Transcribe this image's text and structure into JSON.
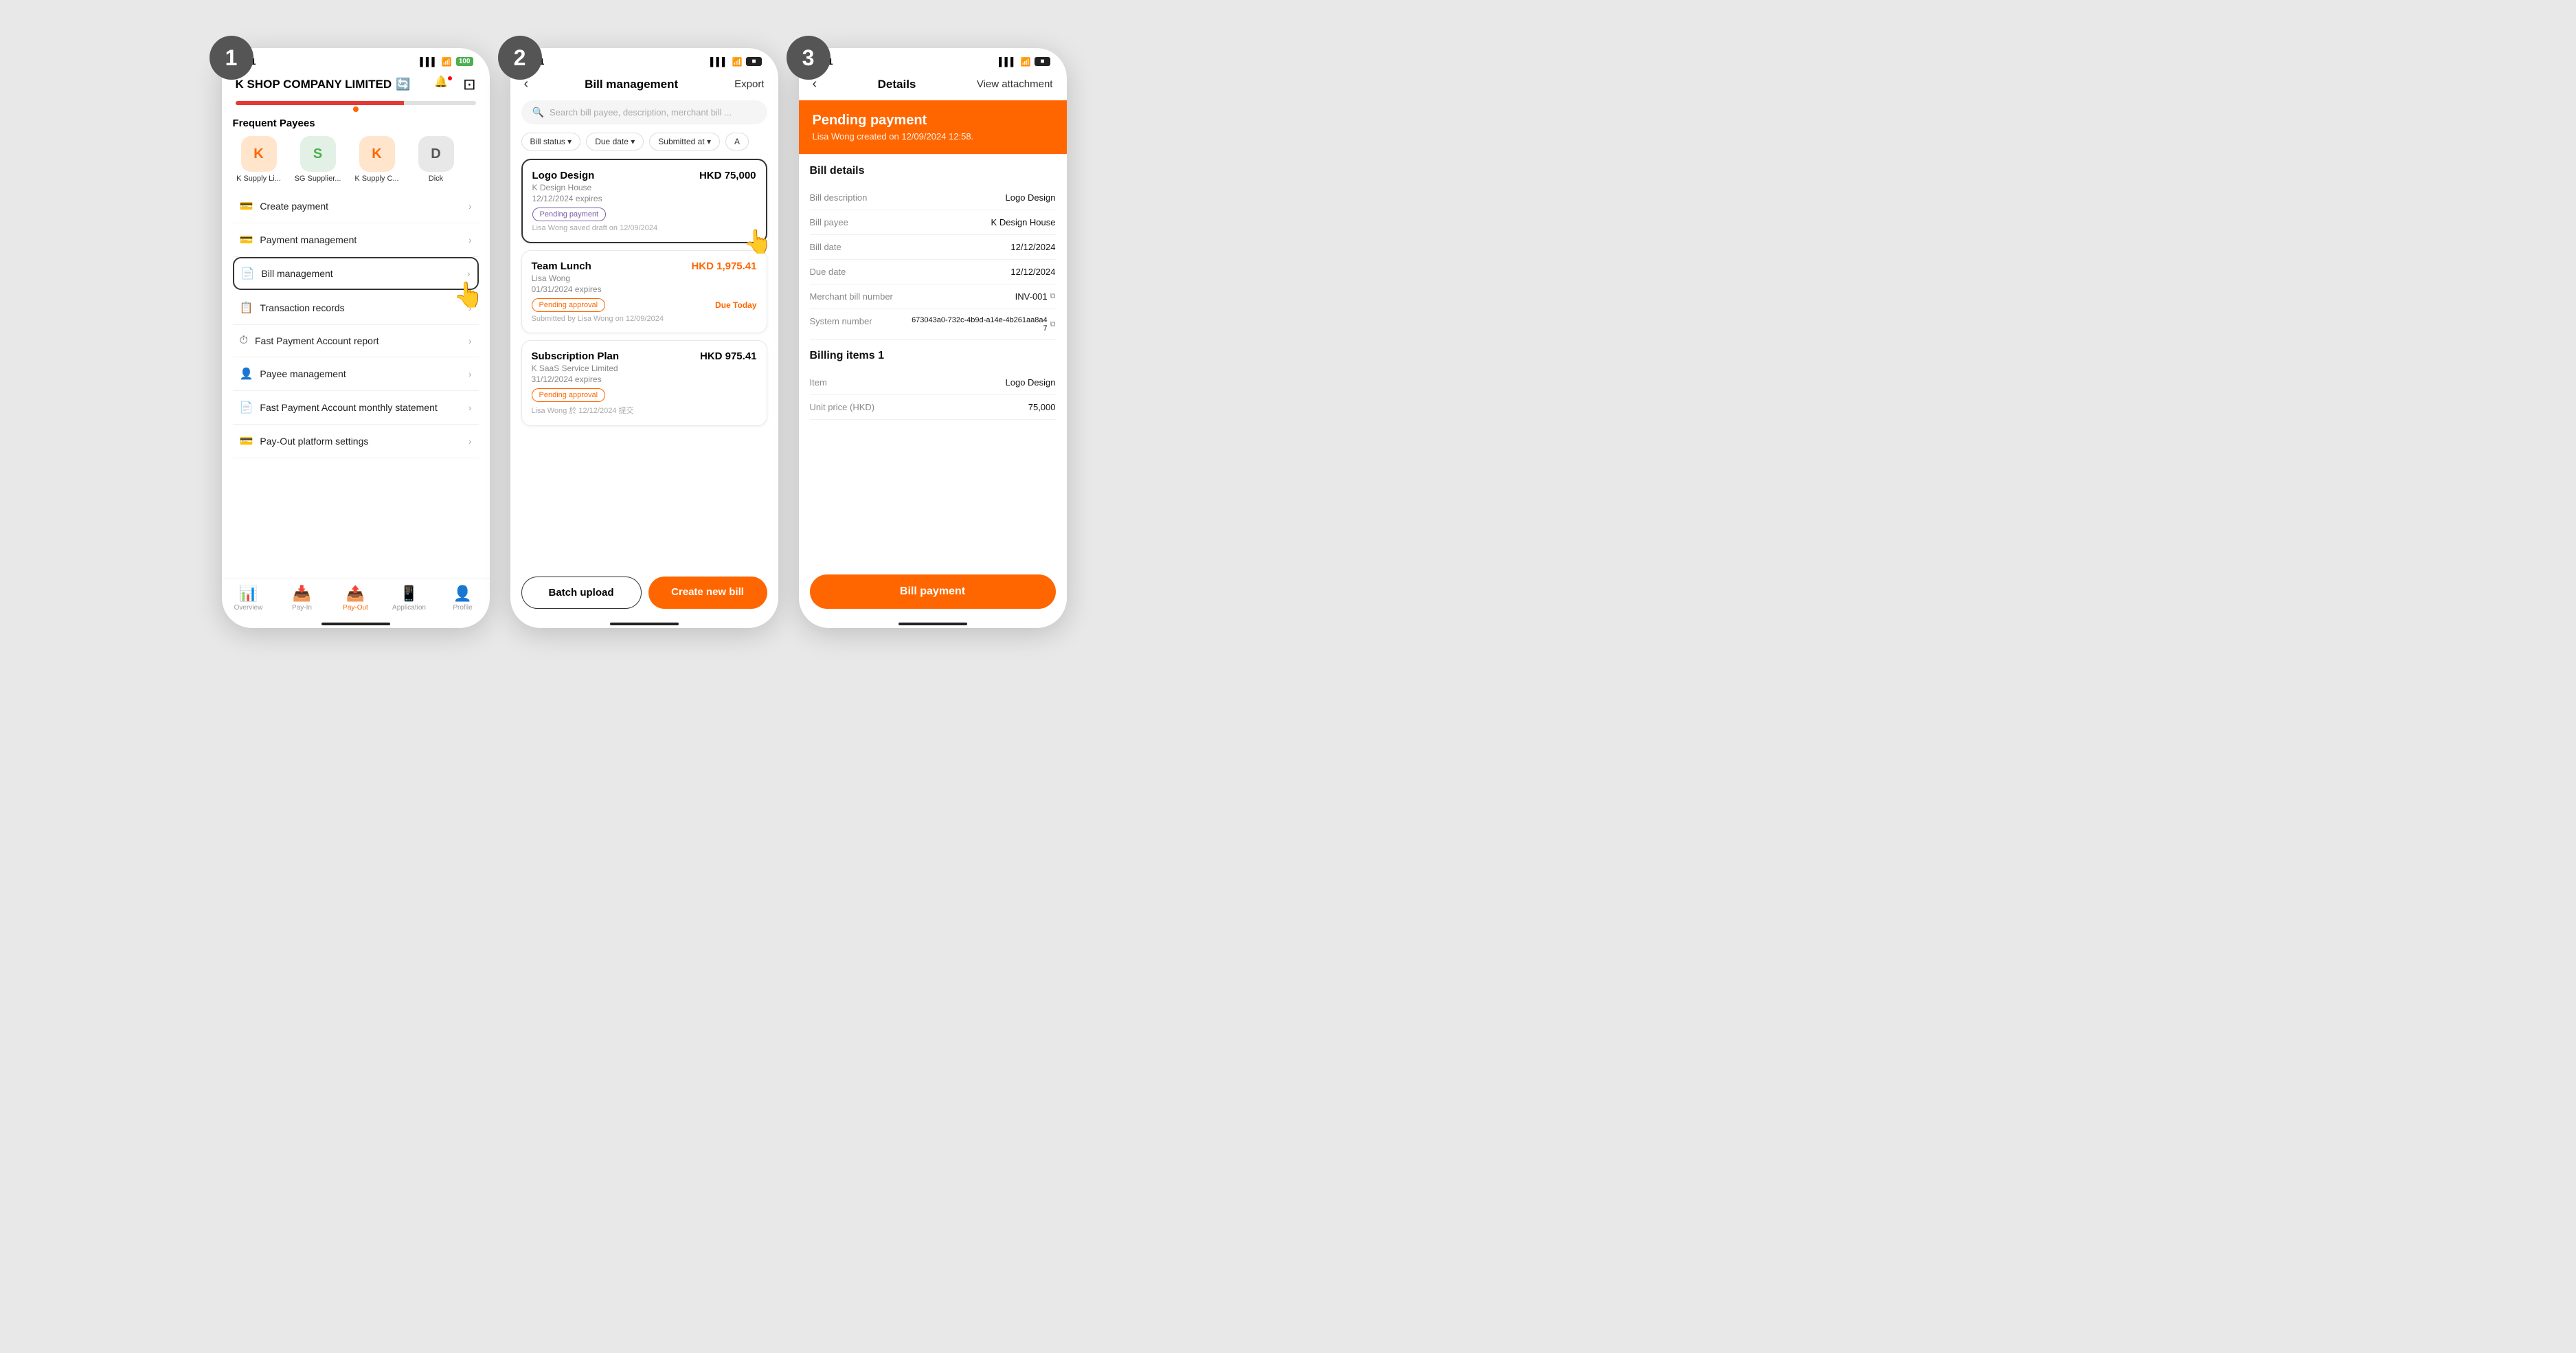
{
  "screen1": {
    "step": "1",
    "status_time": "9:21",
    "company_name": "K SHOP COMPANY LIMITED",
    "frequent_payees_title": "Frequent Payees",
    "payees": [
      {
        "initial": "K",
        "name": "K Supply Li..."
      },
      {
        "initial": "S",
        "name": "SG Supplier..."
      },
      {
        "initial": "K",
        "name": "K Supply C..."
      },
      {
        "initial": "D",
        "name": "Dick"
      }
    ],
    "menu_items": [
      {
        "icon": "💳",
        "label": "Create payment"
      },
      {
        "icon": "💳",
        "label": "Payment management"
      },
      {
        "icon": "📄",
        "label": "Bill management"
      },
      {
        "icon": "📋",
        "label": "Transaction records"
      },
      {
        "icon": "⏱",
        "label": "Fast Payment Account report"
      },
      {
        "icon": "👤",
        "label": "Payee management"
      },
      {
        "icon": "📄",
        "label": "Fast Payment Account monthly statement"
      },
      {
        "icon": "💳",
        "label": "Pay-Out platform settings"
      }
    ],
    "nav": {
      "items": [
        {
          "icon": "📊",
          "label": "Overview",
          "active": false
        },
        {
          "icon": "📥",
          "label": "Pay-In",
          "active": false
        },
        {
          "icon": "📤",
          "label": "Pay-Out",
          "active": true
        },
        {
          "icon": "📱",
          "label": "Application",
          "active": false
        },
        {
          "icon": "👤",
          "label": "Profile",
          "active": false
        }
      ]
    }
  },
  "screen2": {
    "step": "2",
    "status_time": "9:41",
    "title": "Bill management",
    "export_label": "Export",
    "search_placeholder": "Search bill payee, description, merchant bill ...",
    "filters": [
      "Bill status ▾",
      "Due date ▾",
      "Submitted at ▾",
      "A"
    ],
    "bills": [
      {
        "description": "Logo Design",
        "payee": "K Design House",
        "expires": "12/12/2024 expires",
        "amount": "HKD 75,000",
        "status": "Pending payment",
        "status_type": "pending_payment",
        "submitted": "Lisa Wong saved draft on 12/09/2024",
        "due_today": false
      },
      {
        "description": "Team Lunch",
        "payee": "Lisa Wong",
        "expires": "01/31/2024 expires",
        "amount": "HKD 1,975.41",
        "status": "Pending approval",
        "status_type": "pending_approval",
        "submitted": "Submitted by Lisa Wong on 12/09/2024",
        "due_today": true,
        "due_today_label": "Due Today"
      },
      {
        "description": "Subscription Plan",
        "payee": "K SaaS Service Limited",
        "expires": "31/12/2024 expires",
        "amount": "HKD 975.41",
        "status": "Pending approval",
        "status_type": "pending_approval",
        "submitted": "Lisa Wong 於 12/12/2024 提交",
        "due_today": false
      }
    ],
    "batch_upload": "Batch upload",
    "create_new_bill": "Create new bill"
  },
  "screen3": {
    "step": "3",
    "status_time": "9:41",
    "back_label": "‹",
    "title": "Details",
    "attachment_label": "View attachment",
    "banner_title": "Pending payment",
    "banner_sub": "Lisa Wong created on 12/09/2024 12:58.",
    "bill_details_title": "Bill details",
    "details": [
      {
        "label": "Bill description",
        "value": "Logo Design",
        "copy": false
      },
      {
        "label": "Bill payee",
        "value": "K Design House",
        "copy": false
      },
      {
        "label": "Bill date",
        "value": "12/12/2024",
        "copy": false
      },
      {
        "label": "Due date",
        "value": "12/12/2024",
        "copy": false
      },
      {
        "label": "Merchant bill number",
        "value": "INV-001",
        "copy": true
      },
      {
        "label": "System number",
        "value": "673043a0-732c-4b9d-a14e-4b261aa8a47",
        "copy": true
      }
    ],
    "billing_items_title": "Billing items 1",
    "billing_items": [
      {
        "label": "Item",
        "value": "Logo Design"
      },
      {
        "label": "Unit price (HKD)",
        "value": "75,000"
      }
    ],
    "bill_payment_label": "Bill payment"
  }
}
